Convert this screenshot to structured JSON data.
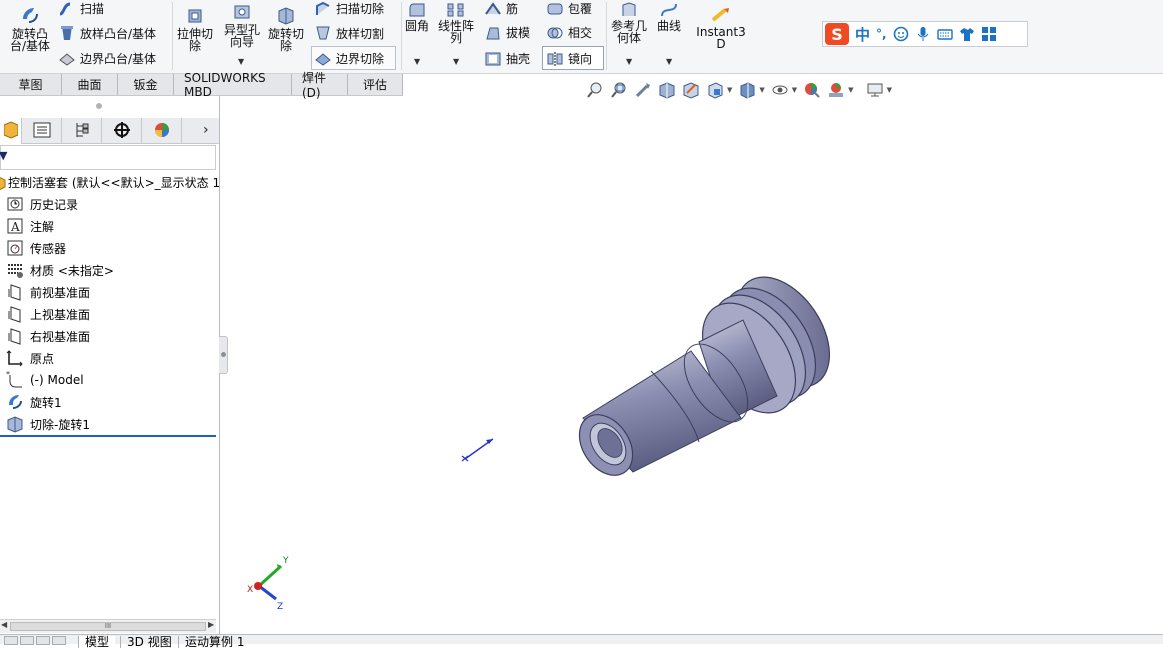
{
  "ribbon": {
    "groups": [
      {
        "label": "旋转凸台/基体"
      },
      {
        "label": "扫描"
      },
      {
        "label": "放样凸台/基体"
      },
      {
        "label": "边界凸台/基体"
      },
      {
        "label": "拉伸切除"
      },
      {
        "label": "异型孔向导"
      },
      {
        "label": "旋转切除"
      },
      {
        "label": "扫描切除"
      },
      {
        "label": "放样切割"
      },
      {
        "label": "边界切除"
      },
      {
        "label": "圆角"
      },
      {
        "label": "线性阵列"
      },
      {
        "label": "筋"
      },
      {
        "label": "拔模"
      },
      {
        "label": "抽壳"
      },
      {
        "label": "包覆"
      },
      {
        "label": "相交"
      },
      {
        "label": "镜向"
      },
      {
        "label": "参考几何体"
      },
      {
        "label": "曲线"
      },
      {
        "label": "Instant3D"
      }
    ]
  },
  "ime": {
    "logo": "S",
    "mode": "中",
    "punct": "°,"
  },
  "tabs": [
    "草图",
    "曲面",
    "钣金",
    "SOLIDWORKS MBD",
    "焊件(D)",
    "评估"
  ],
  "tree": {
    "root": "控制活塞套 (默认<<默认>_显示状态 1",
    "items": [
      {
        "label": "历史记录",
        "icon": "history-icon"
      },
      {
        "label": "注解",
        "icon": "annotation-icon"
      },
      {
        "label": "传感器",
        "icon": "sensor-icon"
      },
      {
        "label": "材质 <未指定>",
        "icon": "material-icon"
      },
      {
        "label": "前视基准面",
        "icon": "plane-icon"
      },
      {
        "label": "上视基准面",
        "icon": "plane-icon"
      },
      {
        "label": "右视基准面",
        "icon": "plane-icon"
      },
      {
        "label": "原点",
        "icon": "origin-icon"
      },
      {
        "label": "(-) Model",
        "icon": "sketch-icon"
      },
      {
        "label": "旋转1",
        "icon": "revolve-icon"
      },
      {
        "label": "切除-旋转1",
        "icon": "cut-revolve-icon"
      }
    ]
  },
  "scroll": {
    "thumb": "III"
  },
  "bottom_tabs": [
    "模型",
    "3D 视图",
    "运动算例 1"
  ],
  "triad": {
    "x": "X",
    "y": "Y",
    "z": "Z"
  }
}
